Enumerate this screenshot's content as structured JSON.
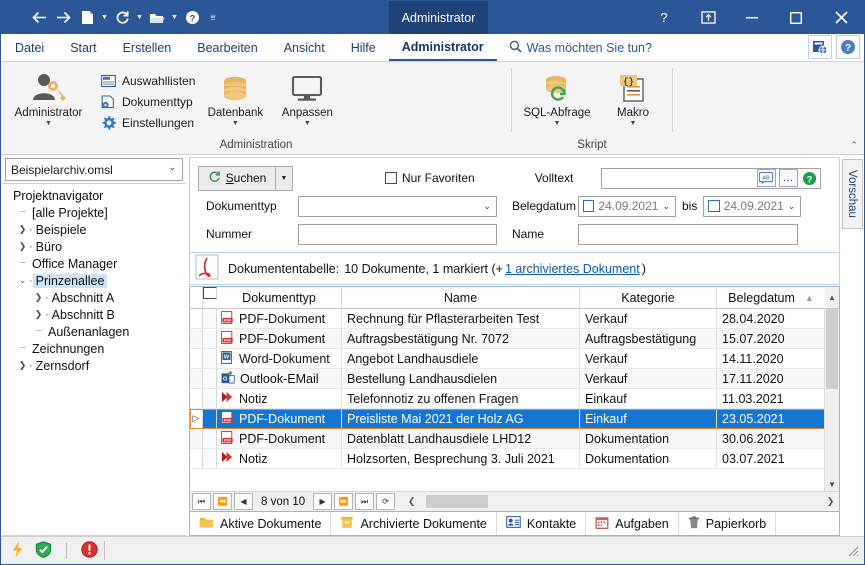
{
  "window": {
    "title": "Administrator",
    "quick_access": [
      "back-arrow",
      "forward-arrow",
      "new-document",
      "refresh",
      "open-folder",
      "help",
      "more"
    ],
    "controls": {
      "help": "?",
      "restore_ribbon": "⏏",
      "minimize": "—",
      "maximize": "▢",
      "close": "✕"
    }
  },
  "ribbon": {
    "tabs": [
      {
        "label": "Datei",
        "active": false
      },
      {
        "label": "Start",
        "active": false
      },
      {
        "label": "Erstellen",
        "active": false
      },
      {
        "label": "Bearbeiten",
        "active": false
      },
      {
        "label": "Ansicht",
        "active": false
      },
      {
        "label": "Hilfe",
        "active": false
      },
      {
        "label": "Administrator",
        "active": true
      }
    ],
    "tell_me": "Was möchten Sie tun?",
    "groups": [
      {
        "label": "Administration",
        "big_buttons": [
          {
            "label": "Administrator",
            "icon": "user-key-icon",
            "has_caret": true
          }
        ],
        "small_buttons": [
          {
            "label": "Auswahllisten",
            "icon": "list-icon"
          },
          {
            "label": "Dokumenttyp",
            "icon": "doctype-icon"
          },
          {
            "label": "Einstellungen",
            "icon": "gear-icon"
          }
        ],
        "big_buttons2": [
          {
            "label": "Datenbank",
            "icon": "database-icon",
            "has_caret": true
          },
          {
            "label": "Anpassen",
            "icon": "monitor-icon",
            "has_caret": true
          }
        ]
      },
      {
        "label": "Skript",
        "big_buttons": [
          {
            "label": "SQL-Abfrage",
            "icon": "sql-query-icon",
            "has_caret": true
          },
          {
            "label": "Makro",
            "icon": "macro-icon",
            "has_caret": true
          }
        ]
      }
    ]
  },
  "navigator": {
    "archive": "Beispielarchiv.omsl",
    "root_label": "Projektnavigator",
    "items": [
      {
        "label": "[alle Projekte]",
        "indent": 1,
        "twisty": "none",
        "selected": false
      },
      {
        "label": "Beispiele",
        "indent": 1,
        "twisty": "collapsed",
        "selected": false
      },
      {
        "label": "Büro",
        "indent": 1,
        "twisty": "collapsed",
        "selected": false
      },
      {
        "label": "Office Manager",
        "indent": 1,
        "twisty": "none",
        "selected": false
      },
      {
        "label": "Prinzenallee",
        "indent": 1,
        "twisty": "expanded",
        "selected": true
      },
      {
        "label": "Abschnitt A",
        "indent": 2,
        "twisty": "collapsed",
        "selected": false
      },
      {
        "label": "Abschnitt B",
        "indent": 2,
        "twisty": "collapsed",
        "selected": false
      },
      {
        "label": "Außenanlagen",
        "indent": 2,
        "twisty": "none",
        "selected": false
      },
      {
        "label": "Zeichnungen",
        "indent": 1,
        "twisty": "none",
        "selected": false
      },
      {
        "label": "Zernsdorf",
        "indent": 1,
        "twisty": "collapsed",
        "selected": false
      }
    ]
  },
  "search": {
    "button": "Suchen",
    "button_accesskey": "S",
    "favorites_label": "Nur Favoriten",
    "favorites_checked": false,
    "doctype_label": "Dokumenttyp",
    "doctype_value": "",
    "number_label": "Nummer",
    "number_value": "",
    "fulltext_label": "Volltext",
    "fulltext_value": "",
    "fulltext_buttons": [
      "AB",
      "...",
      "?"
    ],
    "date_label": "Belegdatum",
    "date_from": "24.09.2021",
    "date_to": "24.09.2021",
    "date_between": "bis",
    "date_from_checked": false,
    "date_to_checked": false,
    "name_label": "Name",
    "name_value": ""
  },
  "doctable": {
    "icon": "pdf-icon",
    "caption": "Dokumententabelle:",
    "summary": "10 Dokumente, 1 markiert (+",
    "link": "1 archiviertes Dokument",
    "summary_end": ")",
    "columns": [
      {
        "label": "Dokumenttyp"
      },
      {
        "label": "Name"
      },
      {
        "label": "Kategorie"
      },
      {
        "label": "Belegdatum",
        "sort": "asc"
      }
    ],
    "rows": [
      {
        "icon": "pdf-icon",
        "type": "PDF-Dokument",
        "name": "Rechnung für Pflasterarbeiten Test",
        "kategorie": "Verkauf",
        "datum": "28.04.2020",
        "selected": false,
        "indicator": ""
      },
      {
        "icon": "pdf-icon",
        "type": "PDF-Dokument",
        "name": "Auftragsbestätigung Nr. 7072",
        "kategorie": "Auftragsbestätigung",
        "datum": "15.07.2020",
        "selected": false,
        "indicator": ""
      },
      {
        "icon": "word-icon",
        "type": "Word-Dokument",
        "name": "Angebot Landhausdiele",
        "kategorie": "Verkauf",
        "datum": "14.11.2020",
        "selected": false,
        "indicator": ""
      },
      {
        "icon": "outlook-icon",
        "type": "Outlook-EMail",
        "name": "Bestellung Landhausdielen",
        "kategorie": "Verkauf",
        "datum": "17.11.2020",
        "selected": false,
        "indicator": ""
      },
      {
        "icon": "note-icon",
        "type": "Notiz",
        "name": "Telefonnotiz zu offenen Fragen",
        "kategorie": "Einkauf",
        "datum": "11.03.2021",
        "selected": false,
        "indicator": ""
      },
      {
        "icon": "pdf-icon",
        "type": "PDF-Dokument",
        "name": "Preisliste Mai 2021 der Holz AG",
        "kategorie": "Einkauf",
        "datum": "23.05.2021",
        "selected": true,
        "indicator": "▷"
      },
      {
        "icon": "pdf-icon",
        "type": "PDF-Dokument",
        "name": "Datenblatt Landhausdiele LHD12",
        "kategorie": "Dokumentation",
        "datum": "30.06.2021",
        "selected": false,
        "indicator": ""
      },
      {
        "icon": "note-icon",
        "type": "Notiz",
        "name": "Holzsorten, Besprechung 3. Juli 2021",
        "kategorie": "Dokumentation",
        "datum": "03.07.2021",
        "selected": false,
        "indicator": ""
      }
    ],
    "pager": {
      "first": "⏮",
      "prev_page": "⏪",
      "prev": "◀",
      "position": "8 von 10",
      "next": "▶",
      "next_page": "⏩",
      "last": "⏭",
      "refresh": "⟳"
    }
  },
  "bottom_tabs": [
    {
      "label": "Aktive Dokumente",
      "icon": "folder-icon",
      "active": true
    },
    {
      "label": "Archivierte Dokumente",
      "icon": "archive-icon",
      "active": false
    },
    {
      "label": "Kontakte",
      "icon": "contact-icon",
      "active": false
    },
    {
      "label": "Aufgaben",
      "icon": "calendar-icon",
      "active": false
    },
    {
      "label": "Papierkorb",
      "icon": "trash-icon",
      "active": false
    }
  ],
  "preview": {
    "label": "Vorschau"
  },
  "statusbar": {
    "icons": [
      "lightning-icon",
      "shield-ok-icon",
      "error-icon"
    ]
  },
  "colors": {
    "titlebar": "#2b5797",
    "accent": "#2b5797",
    "selection": "#1675d1",
    "selection_outline": "#e08a2e",
    "link": "#0b57a4",
    "tree_selection": "#cce4f7"
  }
}
